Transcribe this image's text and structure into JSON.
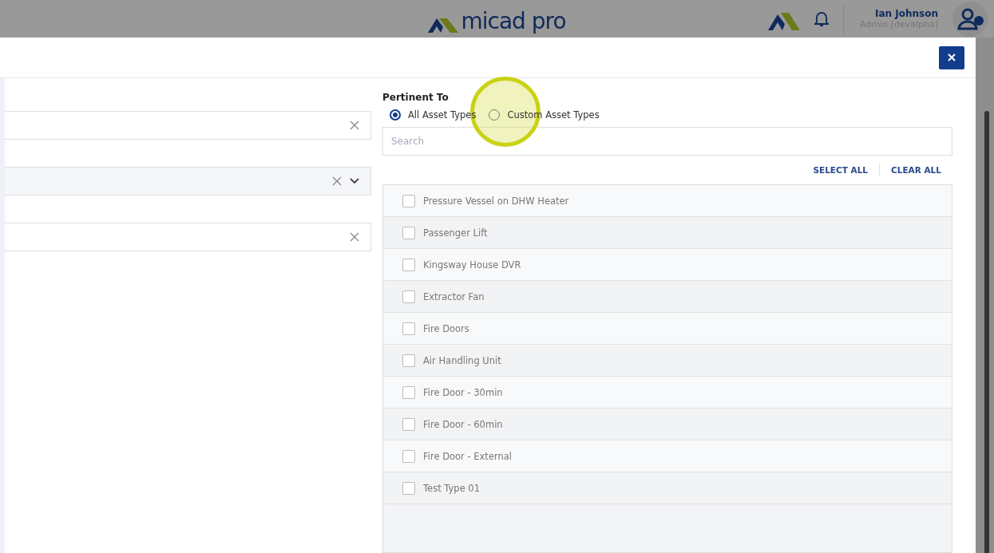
{
  "header": {
    "logo_text": "micad pro",
    "user_name": "Ian Johnson",
    "user_role": "Admin [devalpha]"
  },
  "left_fields": [
    {
      "kind": "clearable"
    },
    {
      "kind": "select"
    },
    {
      "kind": "clearable"
    }
  ],
  "pertinent_to": {
    "label": "Pertinent To",
    "options": [
      {
        "label": "All Asset Types",
        "selected": true
      },
      {
        "label": "Custom Asset Types",
        "selected": false
      }
    ]
  },
  "search": {
    "placeholder": "Search"
  },
  "actions": [
    "SELECT ALL",
    "CLEAR ALL"
  ],
  "asset_types": [
    {
      "label": "Pressure Vessel on DHW Heater",
      "checked": false
    },
    {
      "label": "Passenger Lift",
      "checked": false
    },
    {
      "label": "Kingsway House DVR",
      "checked": false
    },
    {
      "label": "Extractor Fan",
      "checked": false
    },
    {
      "label": "Fire Doors",
      "checked": false
    },
    {
      "label": "Air Handling Unit",
      "checked": false
    },
    {
      "label": "Fire Door - 30min",
      "checked": false
    },
    {
      "label": "Fire Door - 60min",
      "checked": false
    },
    {
      "label": "Fire Door - External",
      "checked": false
    },
    {
      "label": "Test Type 01",
      "checked": false
    }
  ]
}
